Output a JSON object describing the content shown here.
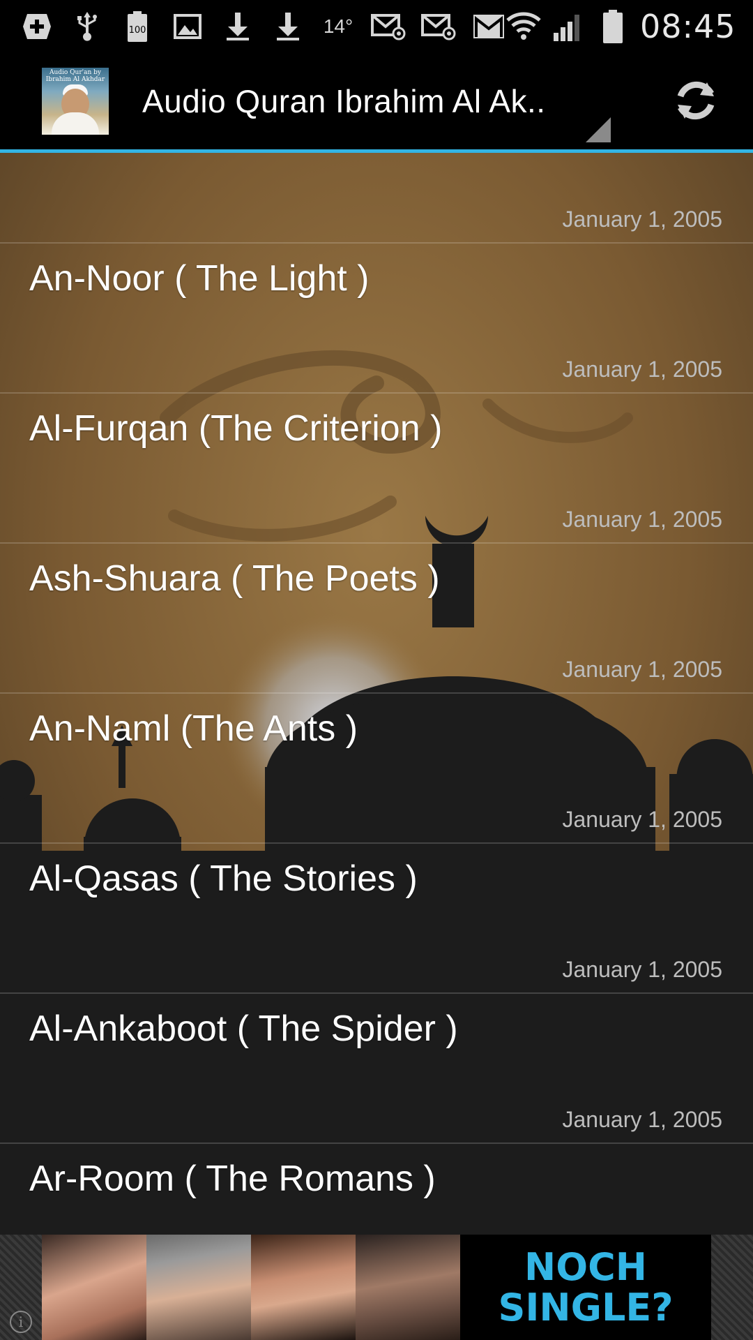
{
  "status_bar": {
    "time": "08:45",
    "temperature": "14°",
    "battery_level": "100",
    "icons": [
      "add-icon",
      "usb-icon",
      "battery-100-icon",
      "image-icon",
      "download-icon",
      "download-icon",
      "temperature-icon",
      "mail-at-icon",
      "mail-at-icon",
      "gmail-icon",
      "wifi-icon",
      "signal-icon",
      "battery-icon"
    ]
  },
  "action_bar": {
    "title": "Audio Quran Ibrahim Al Ak..",
    "logo_text": "Audio Qur'an by Ibrahim Al Akhdar"
  },
  "list": {
    "items": [
      {
        "title": "",
        "date": "January 1, 2005"
      },
      {
        "title": "An-Noor ( The Light )",
        "date": "January 1, 2005"
      },
      {
        "title": "Al-Furqan (The Criterion )",
        "date": "January 1, 2005"
      },
      {
        "title": "Ash-Shuara ( The Poets )",
        "date": "January 1, 2005"
      },
      {
        "title": "An-Naml (The Ants )",
        "date": "January 1, 2005"
      },
      {
        "title": "Al-Qasas ( The Stories )",
        "date": "January 1, 2005"
      },
      {
        "title": "Al-Ankaboot ( The Spider )",
        "date": "January 1, 2005"
      },
      {
        "title": "Ar-Room ( The Romans )",
        "date": ""
      }
    ]
  },
  "ad": {
    "line1": "NOCH",
    "line2": "SINGLE?",
    "info": "i"
  },
  "colors": {
    "accent": "#33b5e5",
    "background_top": "#7a5a32",
    "background_bottom": "#1c1c1c"
  }
}
